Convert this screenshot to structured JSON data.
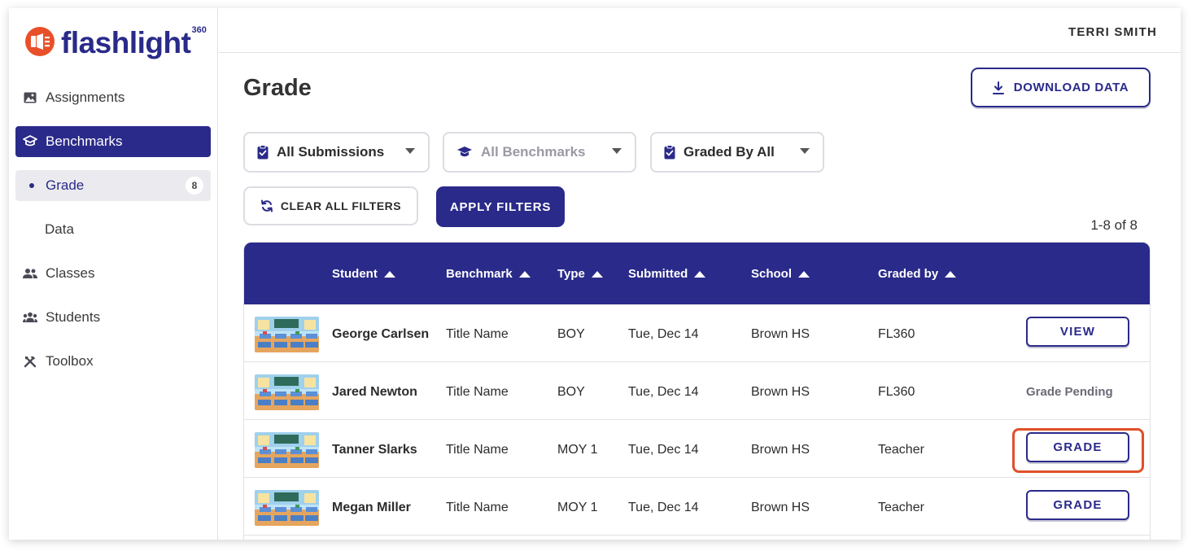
{
  "brand": {
    "name": "flashlight",
    "sup": "360",
    "color": "#2a2a8a",
    "accent": "#e8502a"
  },
  "user": {
    "name": "TERRI SMITH"
  },
  "sidebar": {
    "items": [
      {
        "label": "Assignments",
        "icon": "image-icon"
      },
      {
        "label": "Benchmarks",
        "icon": "graduation-cap-icon",
        "active": true
      },
      {
        "label": "Grade",
        "badge": "8",
        "sub": true
      },
      {
        "label": "Data",
        "sub": true
      },
      {
        "label": "Classes",
        "icon": "people-icon"
      },
      {
        "label": "Students",
        "icon": "group-icon"
      },
      {
        "label": "Toolbox",
        "icon": "tools-icon"
      }
    ]
  },
  "page": {
    "title": "Grade",
    "download_label": "DOWNLOAD DATA",
    "filters": [
      {
        "label": "All Submissions",
        "icon": "clipboard-check-icon"
      },
      {
        "label": "All Benchmarks",
        "icon": "graduation-cap-icon",
        "disabled": true
      },
      {
        "label": "Graded By All",
        "icon": "clipboard-check-icon"
      }
    ],
    "clear_label": "CLEAR ALL FILTERS",
    "apply_label": "APPLY FILTERS",
    "pagination": "1-8 of 8"
  },
  "table": {
    "headers": [
      "Student",
      "Benchmark",
      "Type",
      "Submitted",
      "School",
      "Graded by"
    ],
    "rows": [
      {
        "student": "George Carlsen",
        "benchmark": "Title Name",
        "type": "BOY",
        "submitted": "Tue, Dec 14",
        "school": "Brown HS",
        "graded_by": "FL360",
        "action": "VIEW"
      },
      {
        "student": "Jared Newton",
        "benchmark": "Title Name",
        "type": "BOY",
        "submitted": "Tue, Dec 14",
        "school": "Brown HS",
        "graded_by": "FL360",
        "status": "Grade Pending"
      },
      {
        "student": "Tanner Slarks",
        "benchmark": "Title Name",
        "type": "MOY 1",
        "submitted": "Tue, Dec 14",
        "school": "Brown HS",
        "graded_by": "Teacher",
        "action": "GRADE",
        "highlighted": true
      },
      {
        "student": "Megan Miller",
        "benchmark": "Title Name",
        "type": "MOY 1",
        "submitted": "Tue, Dec 14",
        "school": "Brown HS",
        "graded_by": "Teacher",
        "action": "GRADE"
      }
    ]
  }
}
